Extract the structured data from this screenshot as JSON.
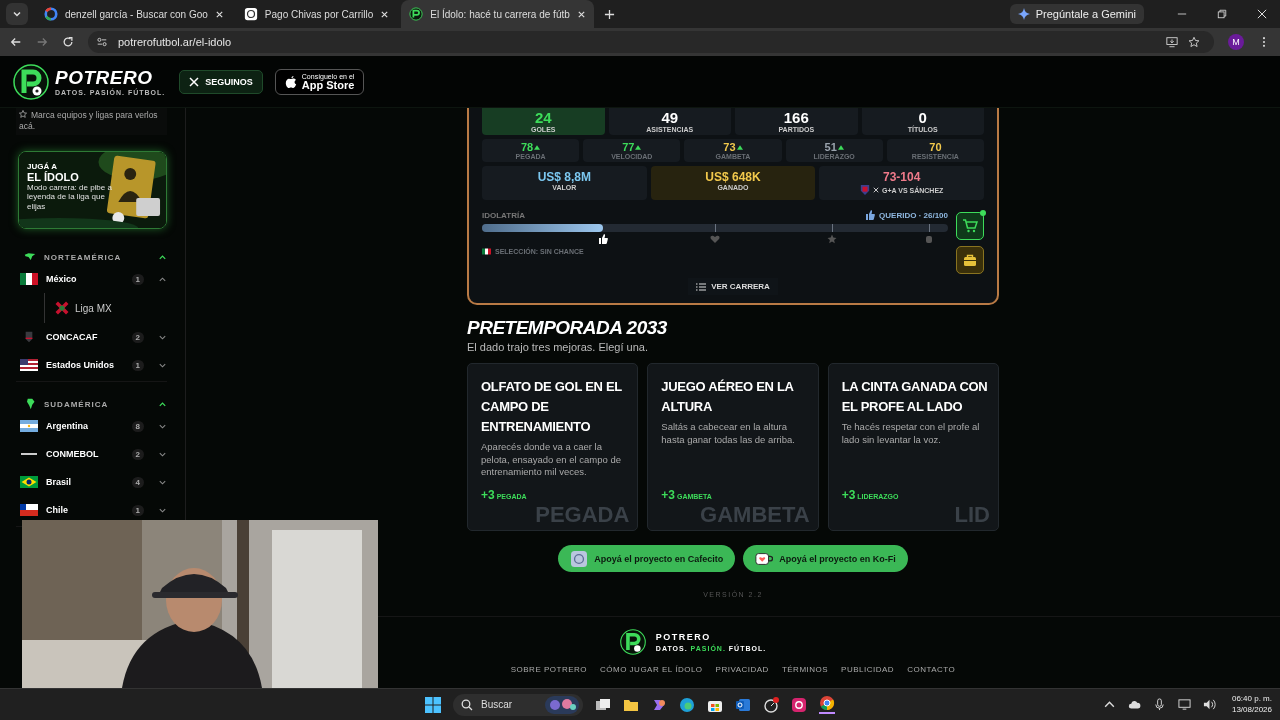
{
  "browser": {
    "tabs": [
      {
        "title": "denzell garcía - Buscar con Goo",
        "kind": "google",
        "selected": false
      },
      {
        "title": "Pago Chivas por Carrillo",
        "kind": "chat",
        "selected": false
      },
      {
        "title": "El Ídolo: hacé tu carrera de fútb",
        "kind": "site",
        "selected": true
      }
    ],
    "gemini": "Pregúntale a Gemini",
    "url": "potrerofutbol.ar/el-idolo",
    "profile": "M"
  },
  "header": {
    "logo": "POTRERO",
    "tagline": "DATOS. PASIÓN. FÚTBOL.",
    "follow_button": "SEGUINOS",
    "store_caption": "Consíguelo en el",
    "store_name": "App Store"
  },
  "sidebar": {
    "hint": "Marca equipos y ligas para verlos acá.",
    "promo": {
      "kicker": "JUGÁ A",
      "title": "EL ÍDOLO",
      "text": "Modo carrera: de pibe a leyenda de la liga que elijas"
    },
    "regions": [
      {
        "name": "NORTEAMÉRICA",
        "expanded": true,
        "items": [
          {
            "name": "México",
            "kind": "mx",
            "count": "1",
            "expanded": true,
            "children": [
              {
                "name": "Liga MX",
                "kind": "league"
              }
            ]
          },
          {
            "name": "CONCACAF",
            "kind": "concacaf",
            "count": "2",
            "expanded": false
          },
          {
            "name": "Estados Unidos",
            "kind": "us",
            "count": "1",
            "expanded": false
          }
        ]
      },
      {
        "name": "SUDAMÉRICA",
        "expanded": true,
        "items": [
          {
            "name": "Argentina",
            "kind": "ar",
            "count": "8",
            "expanded": false
          },
          {
            "name": "CONMEBOL",
            "kind": "conmebol",
            "count": "2",
            "expanded": false
          },
          {
            "name": "Brasil",
            "kind": "br",
            "count": "4",
            "expanded": false
          },
          {
            "name": "Chile",
            "kind": "cl",
            "count": "1",
            "expanded": false
          }
        ]
      }
    ]
  },
  "career": {
    "stats": [
      {
        "label": "GOLES",
        "value": "24",
        "highlighted": true
      },
      {
        "label": "ASISTENCIAS",
        "value": "49",
        "highlighted": false
      },
      {
        "label": "PARTIDOS",
        "value": "166",
        "highlighted": false
      },
      {
        "label": "TÍTULOS",
        "value": "0",
        "highlighted": false
      }
    ],
    "attributes": [
      {
        "label": "PEGADA",
        "value": "78",
        "color": "#3ddc5a",
        "rising": true
      },
      {
        "label": "VELOCIDAD",
        "value": "77",
        "color": "#3ddc5a",
        "rising": true
      },
      {
        "label": "GAMBETA",
        "value": "73",
        "color": "#f2c94c",
        "rising": true
      },
      {
        "label": "LIDERAZGO",
        "value": "51",
        "color": "#9aa3ad",
        "rising": true
      },
      {
        "label": "RESISTENCIA",
        "value": "70",
        "color": "#f2c94c",
        "rising": false
      }
    ],
    "money": [
      {
        "label": "VALOR",
        "value": "US$ 8,8M",
        "kind": "value"
      },
      {
        "label": "GANADO",
        "value": "US$ 648K",
        "kind": "earned"
      },
      {
        "label": "G+A VS SÁNCHEZ",
        "value": "73-104",
        "kind": "rival"
      }
    ],
    "idolatry": {
      "label": "IDOLATRÍA",
      "status": "QUERIDO · 26/100",
      "level": 0.26,
      "milestones": [
        {
          "kind": "thumb",
          "reached": true
        },
        {
          "kind": "heart",
          "reached": false
        },
        {
          "kind": "star",
          "reached": false
        },
        {
          "kind": "fist",
          "reached": false
        }
      ]
    },
    "selection": "SELECCIÓN: SIN CHANCE",
    "shop_badge": true,
    "career_button": "VER CARRERA"
  },
  "preseason": {
    "title": "PRETEMPORADA 2033",
    "subtitle": "El dado trajo tres mejoras. Elegí una.",
    "options": [
      {
        "title": "OLFATO DE GOL EN EL CAMPO DE ENTRENAMIENTO",
        "text": "Aparecés donde va a caer la pelota, ensayado en el campo de entrenamiento mil veces.",
        "bonus": "+3",
        "stat": "PEGADA",
        "watermark": "PEGADA"
      },
      {
        "title": "JUEGO AÉREO EN LA ALTURA",
        "text": "Saltás a cabecear en la altura hasta ganar todas las de arriba.",
        "bonus": "+3",
        "stat": "GAMBETA",
        "watermark": "GAMBETA"
      },
      {
        "title": "LA CINTA GANADA CON EL PROFE AL LADO",
        "text": "Te hacés respetar con el profe al lado sin levantar la voz.",
        "bonus": "+3",
        "stat": "LIDERAZGO",
        "watermark": "LID"
      }
    ]
  },
  "support": [
    {
      "label": "Apoyá el proyecto en Cafecito",
      "kind": "cafecito"
    },
    {
      "label": "Apoyá el proyecto en Ko-Fi",
      "kind": "kofi"
    }
  ],
  "version": "VERSIÓN 2.2",
  "footer": {
    "name": "POTRERO",
    "tagline": [
      {
        "text": "DATOS.",
        "accent": false
      },
      {
        "text": "PASIÓN.",
        "accent": true
      },
      {
        "text": "FÚTBOL.",
        "accent": false
      }
    ],
    "links": [
      "SOBRE POTRERO",
      "CÓMO JUGAR EL ÍDOLO",
      "PRIVACIDAD",
      "TÉRMINOS",
      "PUBLICIDAD",
      "CONTACTO"
    ]
  },
  "taskbar": {
    "search": "Buscar",
    "time": "06:40 p. m.",
    "date": "13/08/2026"
  }
}
